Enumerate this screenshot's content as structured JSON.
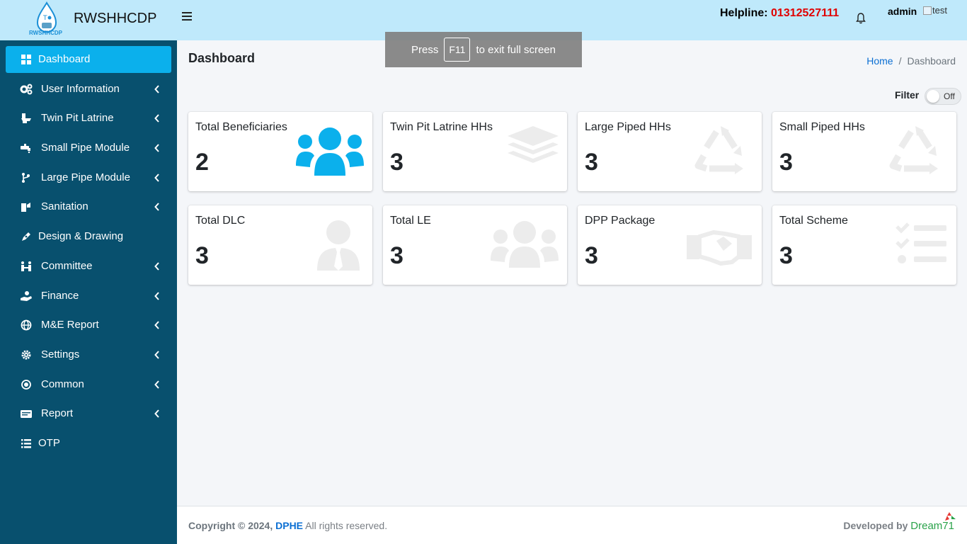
{
  "header": {
    "brand_name": "RWSHHCDP",
    "logo_text": "RWSHHCDP",
    "helpline_label": "Helpline:",
    "helpline_number": "01312527111",
    "user_name": "admin",
    "avatar_alt": "test"
  },
  "overlay": {
    "press": "Press",
    "key": "F11",
    "suffix": "to exit full screen"
  },
  "sidebar": {
    "items": [
      {
        "label": "Dashboard",
        "icon": "dashboard-icon",
        "active": true,
        "has_submenu": false
      },
      {
        "label": "User Information",
        "icon": "users-cog-icon",
        "has_submenu": true
      },
      {
        "label": "Twin Pit Latrine",
        "icon": "toilet-icon",
        "has_submenu": true
      },
      {
        "label": "Small Pipe Module",
        "icon": "faucet-icon",
        "has_submenu": true
      },
      {
        "label": "Large Pipe Module",
        "icon": "branch-icon",
        "has_submenu": true
      },
      {
        "label": "Sanitation",
        "icon": "sanitation-icon",
        "has_submenu": true
      },
      {
        "label": "Design & Drawing",
        "icon": "pen-icon",
        "has_submenu": false
      },
      {
        "label": "Committee",
        "icon": "people-icon",
        "has_submenu": true
      },
      {
        "label": "Finance",
        "icon": "hand-money-icon",
        "has_submenu": true
      },
      {
        "label": "M&E Report",
        "icon": "globe-icon",
        "has_submenu": true
      },
      {
        "label": "Settings",
        "icon": "gear-icon",
        "has_submenu": true
      },
      {
        "label": "Common",
        "icon": "circle-dot-icon",
        "has_submenu": true
      },
      {
        "label": "Report",
        "icon": "card-icon",
        "has_submenu": true
      },
      {
        "label": "OTP",
        "icon": "list-icon",
        "has_submenu": false
      }
    ]
  },
  "main": {
    "title": "Dashboard",
    "breadcrumb": {
      "home": "Home",
      "separator": "/",
      "current": "Dashboard"
    },
    "filter_label": "Filter",
    "filter_state": "Off",
    "cards": [
      {
        "title": "Total Beneficiaries",
        "value": "2",
        "icon": "users-icon",
        "icon_color": "#0bb0ec"
      },
      {
        "title": "Twin Pit Latrine HHs",
        "value": "3",
        "icon": "layers-icon",
        "icon_color": "#ececec"
      },
      {
        "title": "Large Piped HHs",
        "value": "3",
        "icon": "recycle-icon",
        "icon_color": "#ececec"
      },
      {
        "title": "Small Piped HHs",
        "value": "3",
        "icon": "recycle-icon",
        "icon_color": "#ececec"
      },
      {
        "title": "Total DLC",
        "value": "3",
        "icon": "user-tie-icon",
        "icon_color": "#ececec"
      },
      {
        "title": "Total LE",
        "value": "3",
        "icon": "users-icon",
        "icon_color": "#ececec"
      },
      {
        "title": "DPP Package",
        "value": "3",
        "icon": "handshake-icon",
        "icon_color": "#ececec"
      },
      {
        "title": "Total Scheme",
        "value": "3",
        "icon": "tasks-icon",
        "icon_color": "#ececec"
      }
    ]
  },
  "footer": {
    "copyright_prefix": "Copyright © 2024,",
    "org": "DPHE",
    "rights": "All rights reserved.",
    "developed_by": "Developed by",
    "developer": "Dream71"
  }
}
